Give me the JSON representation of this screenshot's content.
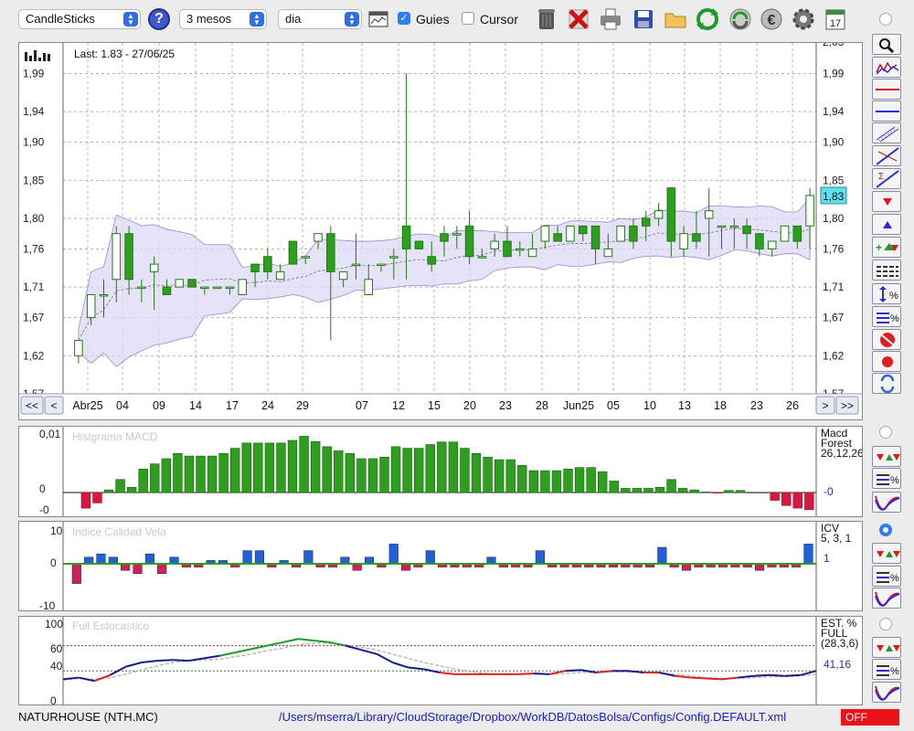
{
  "toolbar": {
    "chart_type": "CandleSticks",
    "period": "3 mesos",
    "interval": "dia",
    "guides_label": "Guies",
    "guides_checked": true,
    "cursor_label": "Cursor",
    "cursor_checked": false,
    "help_label": "?",
    "calendar_day": "17",
    "icons": [
      "chart-window-icon",
      "trash-icon",
      "delete-x-icon",
      "printer-icon",
      "save-icon",
      "folder-icon",
      "refresh-icon",
      "cycle-icon",
      "euro-icon",
      "gear-icon",
      "calendar-icon"
    ]
  },
  "main_chart": {
    "last_label": "Last: 1.83 - 27/06/25",
    "price_badge": "1,83",
    "y_ticks_left": [
      "1,99",
      "1,94",
      "1,90",
      "1,85",
      "1,80",
      "1,76",
      "1,71",
      "1,67",
      "1,62",
      "1,57"
    ],
    "y_ticks_right": [
      "1,99",
      "1,94",
      "1,90",
      "1,85",
      "1,80",
      "1,76",
      "1,71",
      "1,67",
      "1,62",
      "1,57"
    ],
    "top_cut_label": "2,03",
    "x_labels": [
      "Abr25",
      "04",
      "09",
      "14",
      "17",
      "24",
      "29",
      "07",
      "12",
      "15",
      "20",
      "23",
      "28",
      "Jun25",
      "05",
      "10",
      "13",
      "18",
      "23",
      "26"
    ],
    "nav": {
      "first": "<<",
      "prev": "<",
      "next": ">",
      "last": ">>"
    },
    "colors": {
      "bull": "#2e9e1e",
      "bear": "#2e9e1e",
      "band": "#ddd8f5",
      "band_line": "#9988d8"
    }
  },
  "chart_data": [
    {
      "type": "candlestick",
      "title": "NATURHOUSE (NTH.MC)",
      "ylim": [
        1.57,
        2.03
      ],
      "ohlc": [
        {
          "o": 1.62,
          "h": 1.64,
          "l": 1.61,
          "c": 1.64
        },
        {
          "o": 1.67,
          "h": 1.7,
          "l": 1.66,
          "c": 1.7
        },
        {
          "o": 1.7,
          "h": 1.72,
          "l": 1.67,
          "c": 1.7
        },
        {
          "o": 1.72,
          "h": 1.79,
          "l": 1.69,
          "c": 1.78
        },
        {
          "o": 1.78,
          "h": 1.79,
          "l": 1.7,
          "c": 1.72
        },
        {
          "o": 1.71,
          "h": 1.72,
          "l": 1.69,
          "c": 1.71
        },
        {
          "o": 1.73,
          "h": 1.75,
          "l": 1.68,
          "c": 1.74
        },
        {
          "o": 1.71,
          "h": 1.72,
          "l": 1.7,
          "c": 1.7
        },
        {
          "o": 1.71,
          "h": 1.72,
          "l": 1.71,
          "c": 1.72
        },
        {
          "o": 1.72,
          "h": 1.72,
          "l": 1.71,
          "c": 1.71
        },
        {
          "o": 1.71,
          "h": 1.71,
          "l": 1.7,
          "c": 1.71
        },
        {
          "o": 1.71,
          "h": 1.71,
          "l": 1.71,
          "c": 1.71
        },
        {
          "o": 1.71,
          "h": 1.71,
          "l": 1.7,
          "c": 1.71
        },
        {
          "o": 1.7,
          "h": 1.72,
          "l": 1.7,
          "c": 1.72
        },
        {
          "o": 1.74,
          "h": 1.74,
          "l": 1.71,
          "c": 1.73
        },
        {
          "o": 1.75,
          "h": 1.76,
          "l": 1.72,
          "c": 1.73
        },
        {
          "o": 1.72,
          "h": 1.74,
          "l": 1.72,
          "c": 1.73
        },
        {
          "o": 1.77,
          "h": 1.77,
          "l": 1.74,
          "c": 1.74
        },
        {
          "o": 1.75,
          "h": 1.75,
          "l": 1.74,
          "c": 1.75
        },
        {
          "o": 1.77,
          "h": 1.78,
          "l": 1.76,
          "c": 1.78
        },
        {
          "o": 1.78,
          "h": 1.79,
          "l": 1.64,
          "c": 1.73
        },
        {
          "o": 1.72,
          "h": 1.73,
          "l": 1.71,
          "c": 1.73
        },
        {
          "o": 1.74,
          "h": 1.78,
          "l": 1.72,
          "c": 1.74
        },
        {
          "o": 1.7,
          "h": 1.74,
          "l": 1.7,
          "c": 1.72
        },
        {
          "o": 1.74,
          "h": 1.74,
          "l": 1.73,
          "c": 1.74
        },
        {
          "o": 1.75,
          "h": 1.76,
          "l": 1.72,
          "c": 1.75
        },
        {
          "o": 1.79,
          "h": 1.99,
          "l": 1.72,
          "c": 1.76
        },
        {
          "o": 1.77,
          "h": 1.77,
          "l": 1.76,
          "c": 1.76
        },
        {
          "o": 1.75,
          "h": 1.77,
          "l": 1.73,
          "c": 1.74
        },
        {
          "o": 1.78,
          "h": 1.79,
          "l": 1.75,
          "c": 1.77
        },
        {
          "o": 1.78,
          "h": 1.79,
          "l": 1.76,
          "c": 1.78
        },
        {
          "o": 1.79,
          "h": 1.81,
          "l": 1.74,
          "c": 1.75
        },
        {
          "o": 1.75,
          "h": 1.76,
          "l": 1.75,
          "c": 1.75
        },
        {
          "o": 1.76,
          "h": 1.78,
          "l": 1.75,
          "c": 1.77
        },
        {
          "o": 1.77,
          "h": 1.79,
          "l": 1.75,
          "c": 1.75
        },
        {
          "o": 1.76,
          "h": 1.77,
          "l": 1.75,
          "c": 1.76
        },
        {
          "o": 1.75,
          "h": 1.78,
          "l": 1.75,
          "c": 1.76
        },
        {
          "o": 1.77,
          "h": 1.79,
          "l": 1.76,
          "c": 1.79
        },
        {
          "o": 1.78,
          "h": 1.79,
          "l": 1.77,
          "c": 1.77
        },
        {
          "o": 1.77,
          "h": 1.79,
          "l": 1.77,
          "c": 1.79
        },
        {
          "o": 1.79,
          "h": 1.79,
          "l": 1.77,
          "c": 1.78
        },
        {
          "o": 1.79,
          "h": 1.79,
          "l": 1.74,
          "c": 1.76
        },
        {
          "o": 1.75,
          "h": 1.78,
          "l": 1.75,
          "c": 1.76
        },
        {
          "o": 1.77,
          "h": 1.79,
          "l": 1.77,
          "c": 1.79
        },
        {
          "o": 1.79,
          "h": 1.8,
          "l": 1.76,
          "c": 1.77
        },
        {
          "o": 1.8,
          "h": 1.81,
          "l": 1.77,
          "c": 1.79
        },
        {
          "o": 1.8,
          "h": 1.82,
          "l": 1.79,
          "c": 1.81
        },
        {
          "o": 1.84,
          "h": 1.84,
          "l": 1.75,
          "c": 1.77
        },
        {
          "o": 1.76,
          "h": 1.79,
          "l": 1.75,
          "c": 1.78
        },
        {
          "o": 1.78,
          "h": 1.81,
          "l": 1.76,
          "c": 1.77
        },
        {
          "o": 1.8,
          "h": 1.84,
          "l": 1.75,
          "c": 1.81
        },
        {
          "o": 1.79,
          "h": 1.79,
          "l": 1.76,
          "c": 1.79
        },
        {
          "o": 1.79,
          "h": 1.8,
          "l": 1.76,
          "c": 1.79
        },
        {
          "o": 1.79,
          "h": 1.8,
          "l": 1.76,
          "c": 1.78
        },
        {
          "o": 1.78,
          "h": 1.78,
          "l": 1.75,
          "c": 1.76
        },
        {
          "o": 1.76,
          "h": 1.77,
          "l": 1.75,
          "c": 1.77
        },
        {
          "o": 1.77,
          "h": 1.79,
          "l": 1.77,
          "c": 1.79
        },
        {
          "o": 1.79,
          "h": 1.79,
          "l": 1.76,
          "c": 1.77
        },
        {
          "o": 1.79,
          "h": 1.84,
          "l": 1.76,
          "c": 1.83
        }
      ]
    },
    {
      "type": "bar",
      "title": "Histgrama MACD",
      "labels": [
        "Macd",
        "Forest",
        "26,12,26"
      ],
      "value_label": "-0",
      "y_ticks": [
        "0,01",
        "0",
        "-0"
      ],
      "values": [
        -0.003,
        -0.002,
        0.0005,
        0.0025,
        0.001,
        0.0045,
        0.0055,
        0.0065,
        0.0075,
        0.007,
        0.007,
        0.007,
        0.0075,
        0.0085,
        0.0095,
        0.0095,
        0.0095,
        0.0095,
        0.01,
        0.0108,
        0.0098,
        0.0088,
        0.008,
        0.0075,
        0.0065,
        0.0065,
        0.0068,
        0.0088,
        0.0085,
        0.0085,
        0.0092,
        0.0097,
        0.0097,
        0.0085,
        0.0075,
        0.0068,
        0.0063,
        0.0063,
        0.0052,
        0.0042,
        0.0042,
        0.0042,
        0.0045,
        0.0048,
        0.0048,
        0.004,
        0.0022,
        0.0008,
        0.0008,
        0.0008,
        0.001,
        0.0025,
        0.0008,
        0.0005,
        0.0001,
        -0.0001,
        0.0004,
        0.0004,
        0,
        0,
        -0.0015,
        -0.0025,
        -0.003,
        -0.0033
      ]
    },
    {
      "type": "bar",
      "title": "Indice Calidad Vela",
      "labels": [
        "ICV",
        "5, 3, 1"
      ],
      "value_label": "1",
      "y_ticks": [
        "10",
        "0",
        "-10"
      ],
      "values": [
        -6,
        2,
        3,
        2,
        -2,
        -3,
        3,
        -3,
        2,
        -1,
        -1,
        1,
        1,
        -1,
        4,
        4,
        -1,
        1,
        -1,
        4,
        -1,
        -1,
        2,
        -2,
        2,
        -1,
        6,
        -2,
        -1,
        4,
        -1,
        -1,
        -1,
        -1,
        2,
        -1,
        -1,
        -1,
        4,
        -1,
        -1,
        -1,
        -1,
        -1,
        -1,
        -1,
        -1,
        -1,
        5,
        -1,
        -2,
        -1,
        -1,
        -1,
        -1,
        -1,
        -2,
        -1,
        -1,
        -1,
        6
      ],
      "positive_color": "#2060d8",
      "negative_color": "#d0205a"
    },
    {
      "type": "line",
      "title": "Full Estocastico",
      "labels": [
        "EST. %",
        "FULL",
        "(28,3,6)"
      ],
      "value_label": "41,16",
      "y_ticks": [
        "100",
        "60",
        "40",
        "0"
      ],
      "ylim": [
        0,
        100
      ],
      "reference_lines": [
        70,
        40
      ],
      "series": [
        {
          "color": "#1a1a8c",
          "values": [
            30,
            32,
            28,
            35,
            45,
            50,
            52,
            53,
            52,
            55,
            58,
            62,
            66,
            70,
            74,
            78,
            76,
            74,
            70,
            65,
            60,
            50,
            44,
            42,
            38,
            36,
            36,
            36,
            36,
            36,
            37,
            36,
            40,
            41,
            38,
            40,
            40,
            38,
            38,
            34,
            32,
            31,
            30,
            32,
            34,
            35,
            34,
            35,
            40
          ]
        },
        {
          "color": "#d0d0d0",
          "values": [
            29,
            31,
            30,
            32,
            36,
            41,
            46,
            50,
            52,
            53,
            54,
            57,
            60,
            64,
            67,
            71,
            73,
            73,
            71,
            68,
            65,
            60,
            55,
            50,
            46,
            42,
            39,
            37,
            36,
            36,
            36,
            36,
            37,
            38,
            38,
            39,
            39,
            38,
            37,
            36,
            34,
            32,
            31,
            31,
            32,
            33,
            33,
            34,
            36
          ]
        }
      ]
    }
  ],
  "side_buttons": [
    "zoom-icon",
    "chart-indicator-icon",
    "hline-red-icon",
    "hline-blue-icon",
    "channel-icon",
    "trendline-icon",
    "fibo-icon",
    "down-arrow-icon",
    "up-arrow-icon",
    "add-marker-icon",
    "lines-icon",
    "scale-percent-icon",
    "percent-icon",
    "no-icon",
    "record-icon",
    "swap-icon"
  ],
  "sub_side": [
    "arrows-icon",
    "percent-lines-icon",
    "curve-icon"
  ],
  "footer": {
    "ticker": "NATURHOUSE (NTH.MC)",
    "path": "/Users/mserra/Library/CloudStorage/Dropbox/WorkDB/DatosBolsa/Configs/Config.DEFAULT.xml",
    "status": "OFF"
  }
}
